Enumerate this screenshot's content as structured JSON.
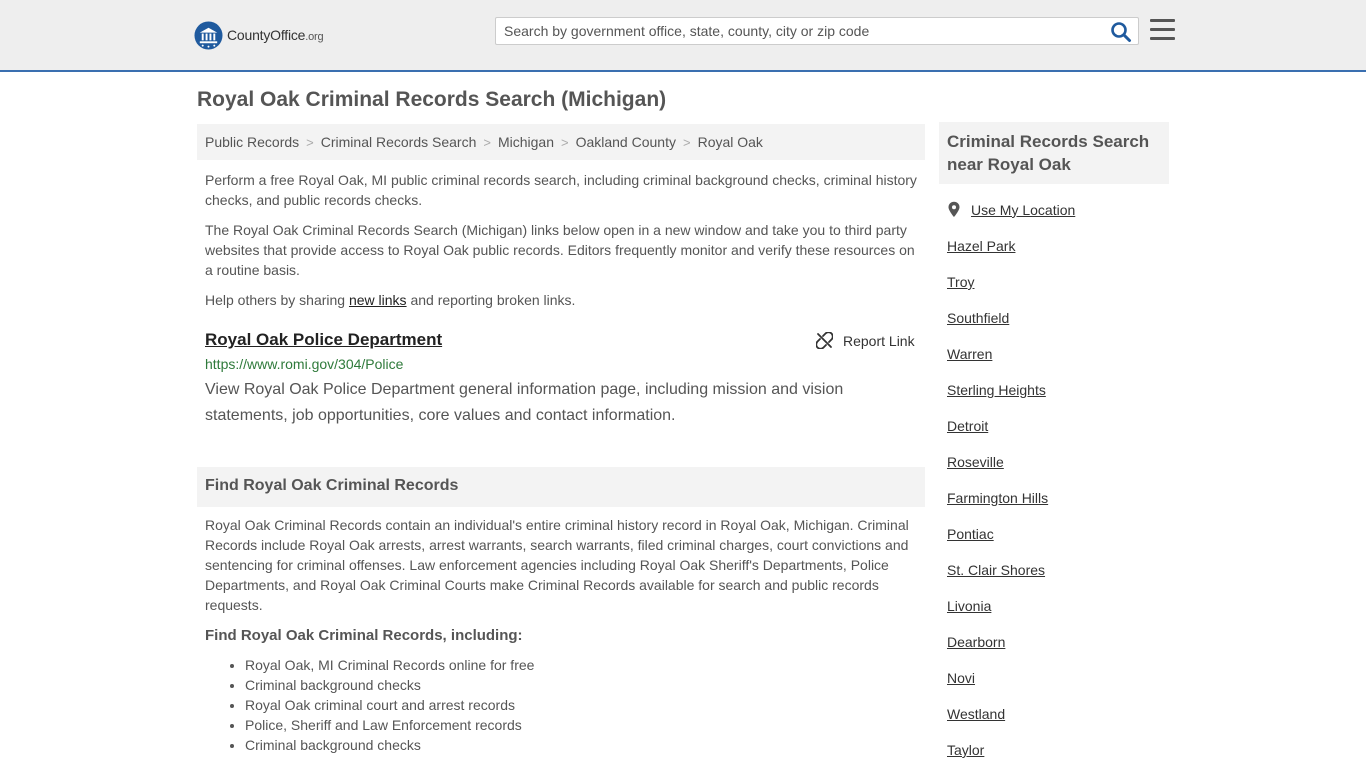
{
  "header": {
    "logo_text_main": "CountyOffice",
    "logo_text_suffix": ".org",
    "search_placeholder": "Search by government office, state, county, city or zip code",
    "colors": {
      "accent": "#3a6fb0",
      "logo": "#1f5a9e"
    }
  },
  "page": {
    "title": "Royal Oak Criminal Records Search (Michigan)"
  },
  "breadcrumb": [
    "Public Records",
    "Criminal Records Search",
    "Michigan",
    "Oakland County",
    "Royal Oak"
  ],
  "intro": {
    "p1": "Perform a free Royal Oak, MI public criminal records search, including criminal background checks, criminal history checks, and public records checks.",
    "p2": "The Royal Oak Criminal Records Search (Michigan) links below open in a new window and take you to third party websites that provide access to Royal Oak public records. Editors frequently monitor and verify these resources on a routine basis.",
    "p3_before": "Help others by sharing ",
    "p3_link": "new links",
    "p3_after": " and reporting broken links."
  },
  "result": {
    "title": "Royal Oak Police Department",
    "url": "https://www.romi.gov/304/Police",
    "description": "View Royal Oak Police Department general information page, including mission and vision statements, job opportunities, core values and contact information.",
    "report_label": "Report Link"
  },
  "find_section": {
    "heading": "Find Royal Oak Criminal Records",
    "body": "Royal Oak Criminal Records contain an individual's entire criminal history record in Royal Oak, Michigan. Criminal Records include Royal Oak arrests, arrest warrants, search warrants, filed criminal charges, court convictions and sentencing for criminal offenses. Law enforcement agencies including Royal Oak Sheriff's Departments, Police Departments, and Royal Oak Criminal Courts make Criminal Records available for search and public records requests.",
    "subheading": "Find Royal Oak Criminal Records, including:",
    "items": [
      "Royal Oak, MI Criminal Records online for free",
      "Criminal background checks",
      "Royal Oak criminal court and arrest records",
      "Police, Sheriff and Law Enforcement records",
      "Criminal background checks"
    ]
  },
  "sidebar": {
    "heading": "Criminal Records Search near Royal Oak",
    "use_location": "Use My Location",
    "cities": [
      "Hazel Park",
      "Troy",
      "Southfield",
      "Warren",
      "Sterling Heights",
      "Detroit",
      "Roseville",
      "Farmington Hills",
      "Pontiac",
      "St. Clair Shores",
      "Livonia",
      "Dearborn",
      "Novi",
      "Westland",
      "Taylor"
    ]
  }
}
